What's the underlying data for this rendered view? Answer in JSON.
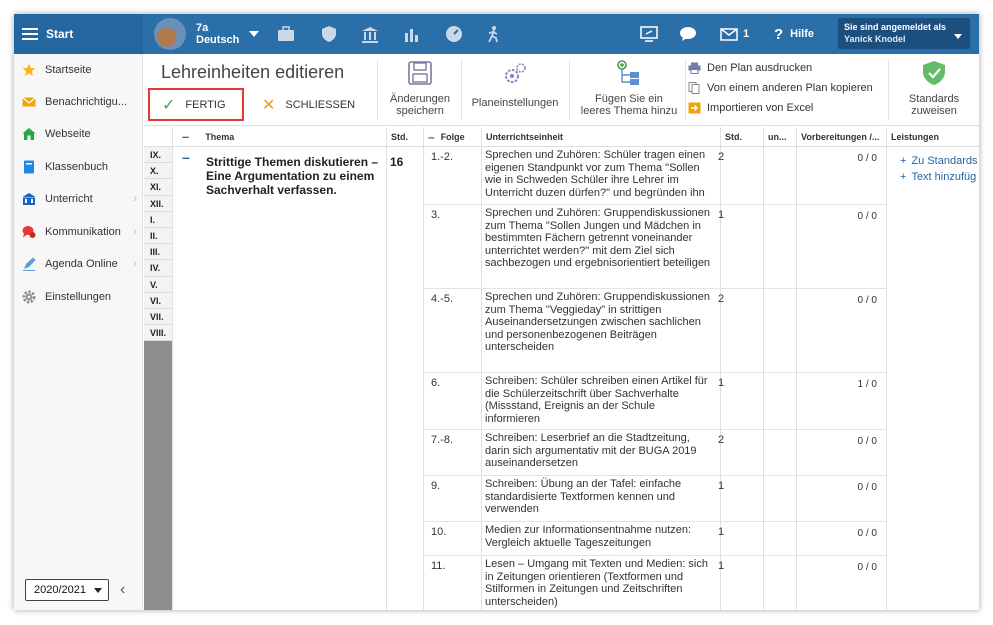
{
  "topbar": {
    "start_label": "Start",
    "class_name": "7a",
    "class_subject": "Deutsch",
    "msg_count": "1",
    "help_label": "Hilfe",
    "login_label": "Sie sind angemeldet als",
    "user_name": "Yanick Knodel"
  },
  "sidebar": {
    "items": [
      {
        "label": "Startseite",
        "icon": "star-icon"
      },
      {
        "label": "Benachrichtigu...",
        "icon": "mail-icon"
      },
      {
        "label": "Webseite",
        "icon": "home-icon"
      },
      {
        "label": "Klassenbuch",
        "icon": "book-icon"
      },
      {
        "label": "Unterricht",
        "icon": "classroom-icon"
      },
      {
        "label": "Kommunikation",
        "icon": "chat-icon"
      },
      {
        "label": "Agenda Online",
        "icon": "pen-icon"
      },
      {
        "label": "Einstellungen",
        "icon": "gear-icon"
      }
    ],
    "year": "2020/2021"
  },
  "toolbar": {
    "title": "Lehreinheiten editieren",
    "done_label": "FERTIG",
    "close_label": "SCHLIESSEN",
    "save_label_1": "Änderungen",
    "save_label_2": "speichern",
    "plan_settings_label": "Planeinstellungen",
    "add_topic_label_1": "Fügen Sie ein",
    "add_topic_label_2": "leeres Thema hinzu",
    "print_label": "Den Plan ausdrucken",
    "copy_label": "Von einem anderen Plan kopieren",
    "import_label": "Importieren von Excel",
    "standards_label_1": "Standards",
    "standards_label_2": "zuweisen"
  },
  "table": {
    "headers": {
      "thema": "Thema",
      "std": "Std.",
      "folge": "Folge",
      "ue": "Unterrichtseinheit",
      "std2": "Std.",
      "un": "un...",
      "vorb": "Vorbereitungen /...",
      "leist": "Leistungen"
    },
    "romans": [
      "IX.",
      "X.",
      "XI.",
      "XII.",
      "I.",
      "II.",
      "III.",
      "IV.",
      "V.",
      "VI.",
      "VII.",
      "VIII."
    ],
    "thema_text": "Strittige Themen diskutieren – Eine Argumentation zu einem Sachverhalt verfassen.",
    "thema_std": "16",
    "rows": [
      {
        "folge": "1.-2.",
        "ue": "Sprechen und Zuhören: Schüler tragen einen eigenen Standpunkt vor zum Thema \"Sollen wie in Schweden Schüler ihre Lehrer im Unterricht duzen dürfen?\" und begründen ihn",
        "std": "2",
        "vorb": "0 / 0"
      },
      {
        "folge": "3.",
        "ue": "Sprechen und Zuhören: Gruppendiskussionen zum Thema \"Sollen Jungen und Mädchen in bestimmten Fächern getrennt voneinander unterrichtet werden?\" mit dem Ziel sich sachbezogen und ergebnisorientiert beteiligen",
        "std": "1",
        "vorb": "0 / 0"
      },
      {
        "folge": "4.-5.",
        "ue": "Sprechen und Zuhören: Gruppendiskussionen zum Thema \"Veggieday\" in strittigen Auseinandersetzungen zwischen sachlichen und personenbezogenen Beiträgen unterscheiden",
        "std": "2",
        "vorb": "0 / 0"
      },
      {
        "folge": "6.",
        "ue": "Schreiben: Schüler schreiben einen Artikel für die Schülerzeitschrift über Sachverhalte (Missstand, Ereignis an der Schule informieren",
        "std": "1",
        "vorb": "1 / 0"
      },
      {
        "folge": "7.-8.",
        "ue": "Schreiben: Leserbrief an die Stadtzeitung, darin sich argumentativ mit der BUGA 2019 auseinandersetzen",
        "std": "2",
        "vorb": "0 / 0"
      },
      {
        "folge": "9.",
        "ue": "Schreiben: Übung an der Tafel: einfache standardisierte Textformen kennen und verwenden",
        "std": "1",
        "vorb": "0 / 0"
      },
      {
        "folge": "10.",
        "ue": "Medien zur Informationsentnahme nutzen: Vergleich aktuelle Tageszeitungen",
        "std": "1",
        "vorb": "0 / 0"
      },
      {
        "folge": "11.",
        "ue": "Lesen – Umgang mit Texten und Medien: sich in Zeitungen orientieren (Textformen und Stilformen in Zeitungen und Zeitschriften unterscheiden)",
        "std": "1",
        "vorb": "0 / 0"
      }
    ],
    "leist_standards": "Zu Standards",
    "leist_text": "Text hinzufüg"
  }
}
